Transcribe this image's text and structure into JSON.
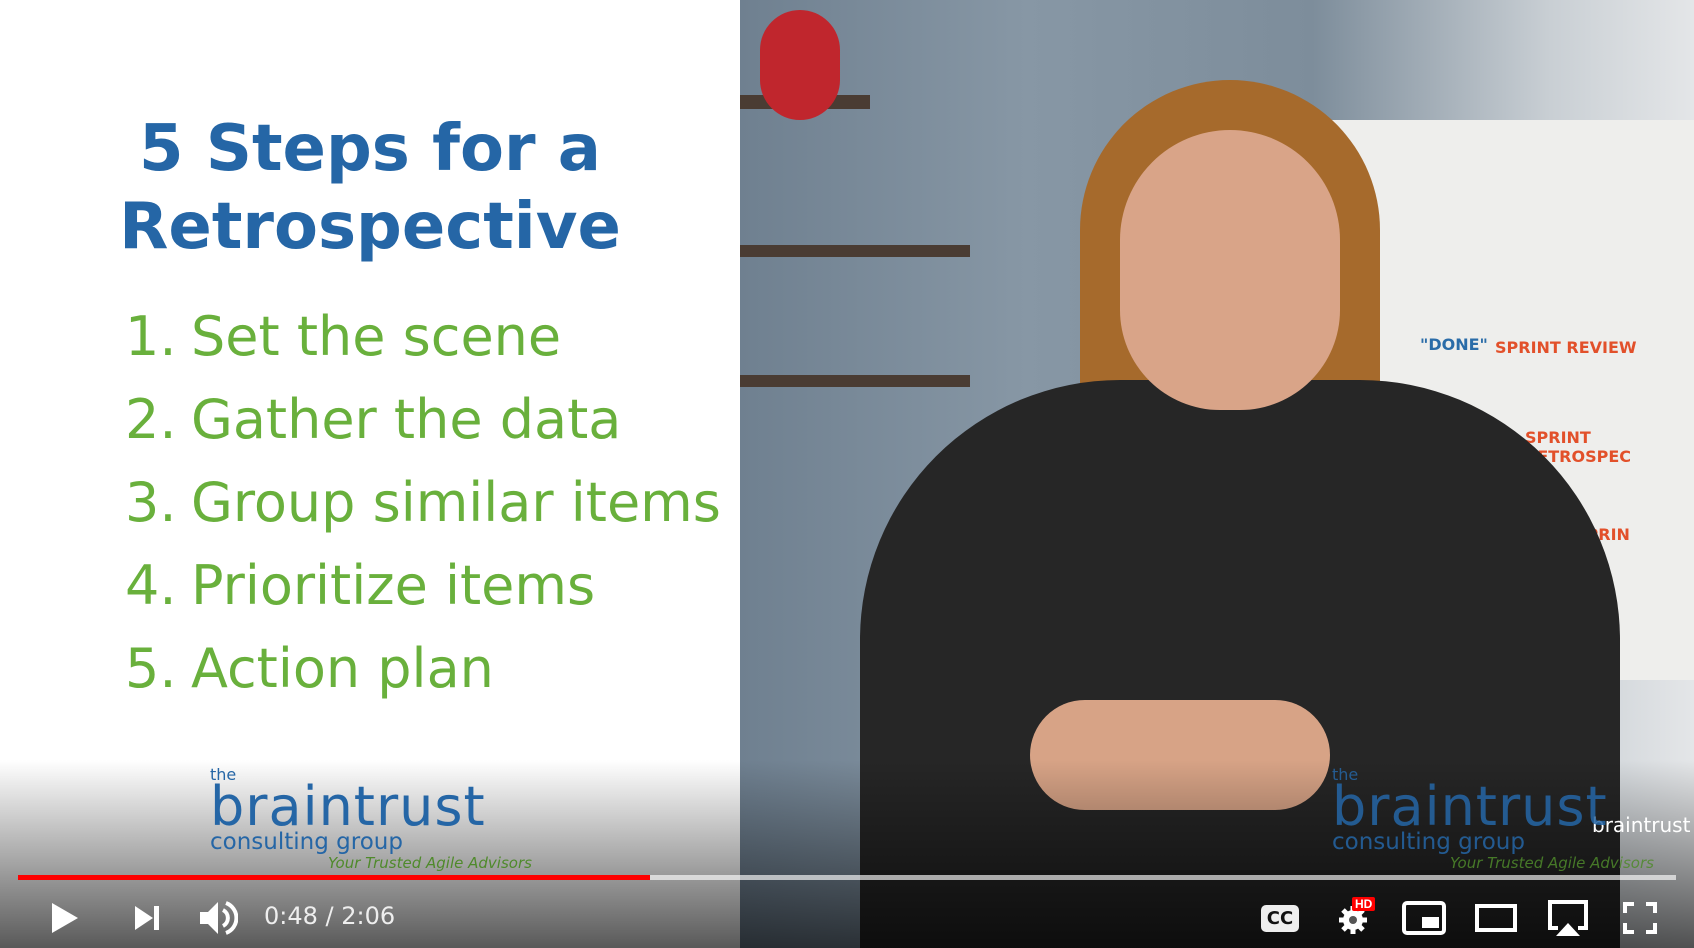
{
  "slide": {
    "title_line1": "5 Steps for a",
    "title_line2": "Retrospective",
    "steps": [
      {
        "num": "1.",
        "text": "Set the scene"
      },
      {
        "num": "2.",
        "text": "Gather the data"
      },
      {
        "num": "3.",
        "text": "Group similar items"
      },
      {
        "num": "4.",
        "text": "Prioritize items"
      },
      {
        "num": "5.",
        "text": "Action plan"
      }
    ]
  },
  "logo": {
    "the": "the",
    "name": "braintrust",
    "sub": "consulting group",
    "tagline": "Your Trusted Agile Advisors"
  },
  "poster": {
    "sprint_review": "SPRINT REVIEW",
    "sprint_retro": "SPRINT RETROSPEC",
    "done": "\"DONE\"",
    "sprint": "SPRIN"
  },
  "player": {
    "current_time": "0:48",
    "duration": "2:06",
    "time_display": "0:48 / 2:06",
    "progress_percent": 38.1,
    "buffered_percent": 100,
    "hd_badge": "HD",
    "cc_label": "CC",
    "colors": {
      "progress": "#ff0000",
      "hd_badge": "#ff0000"
    }
  }
}
